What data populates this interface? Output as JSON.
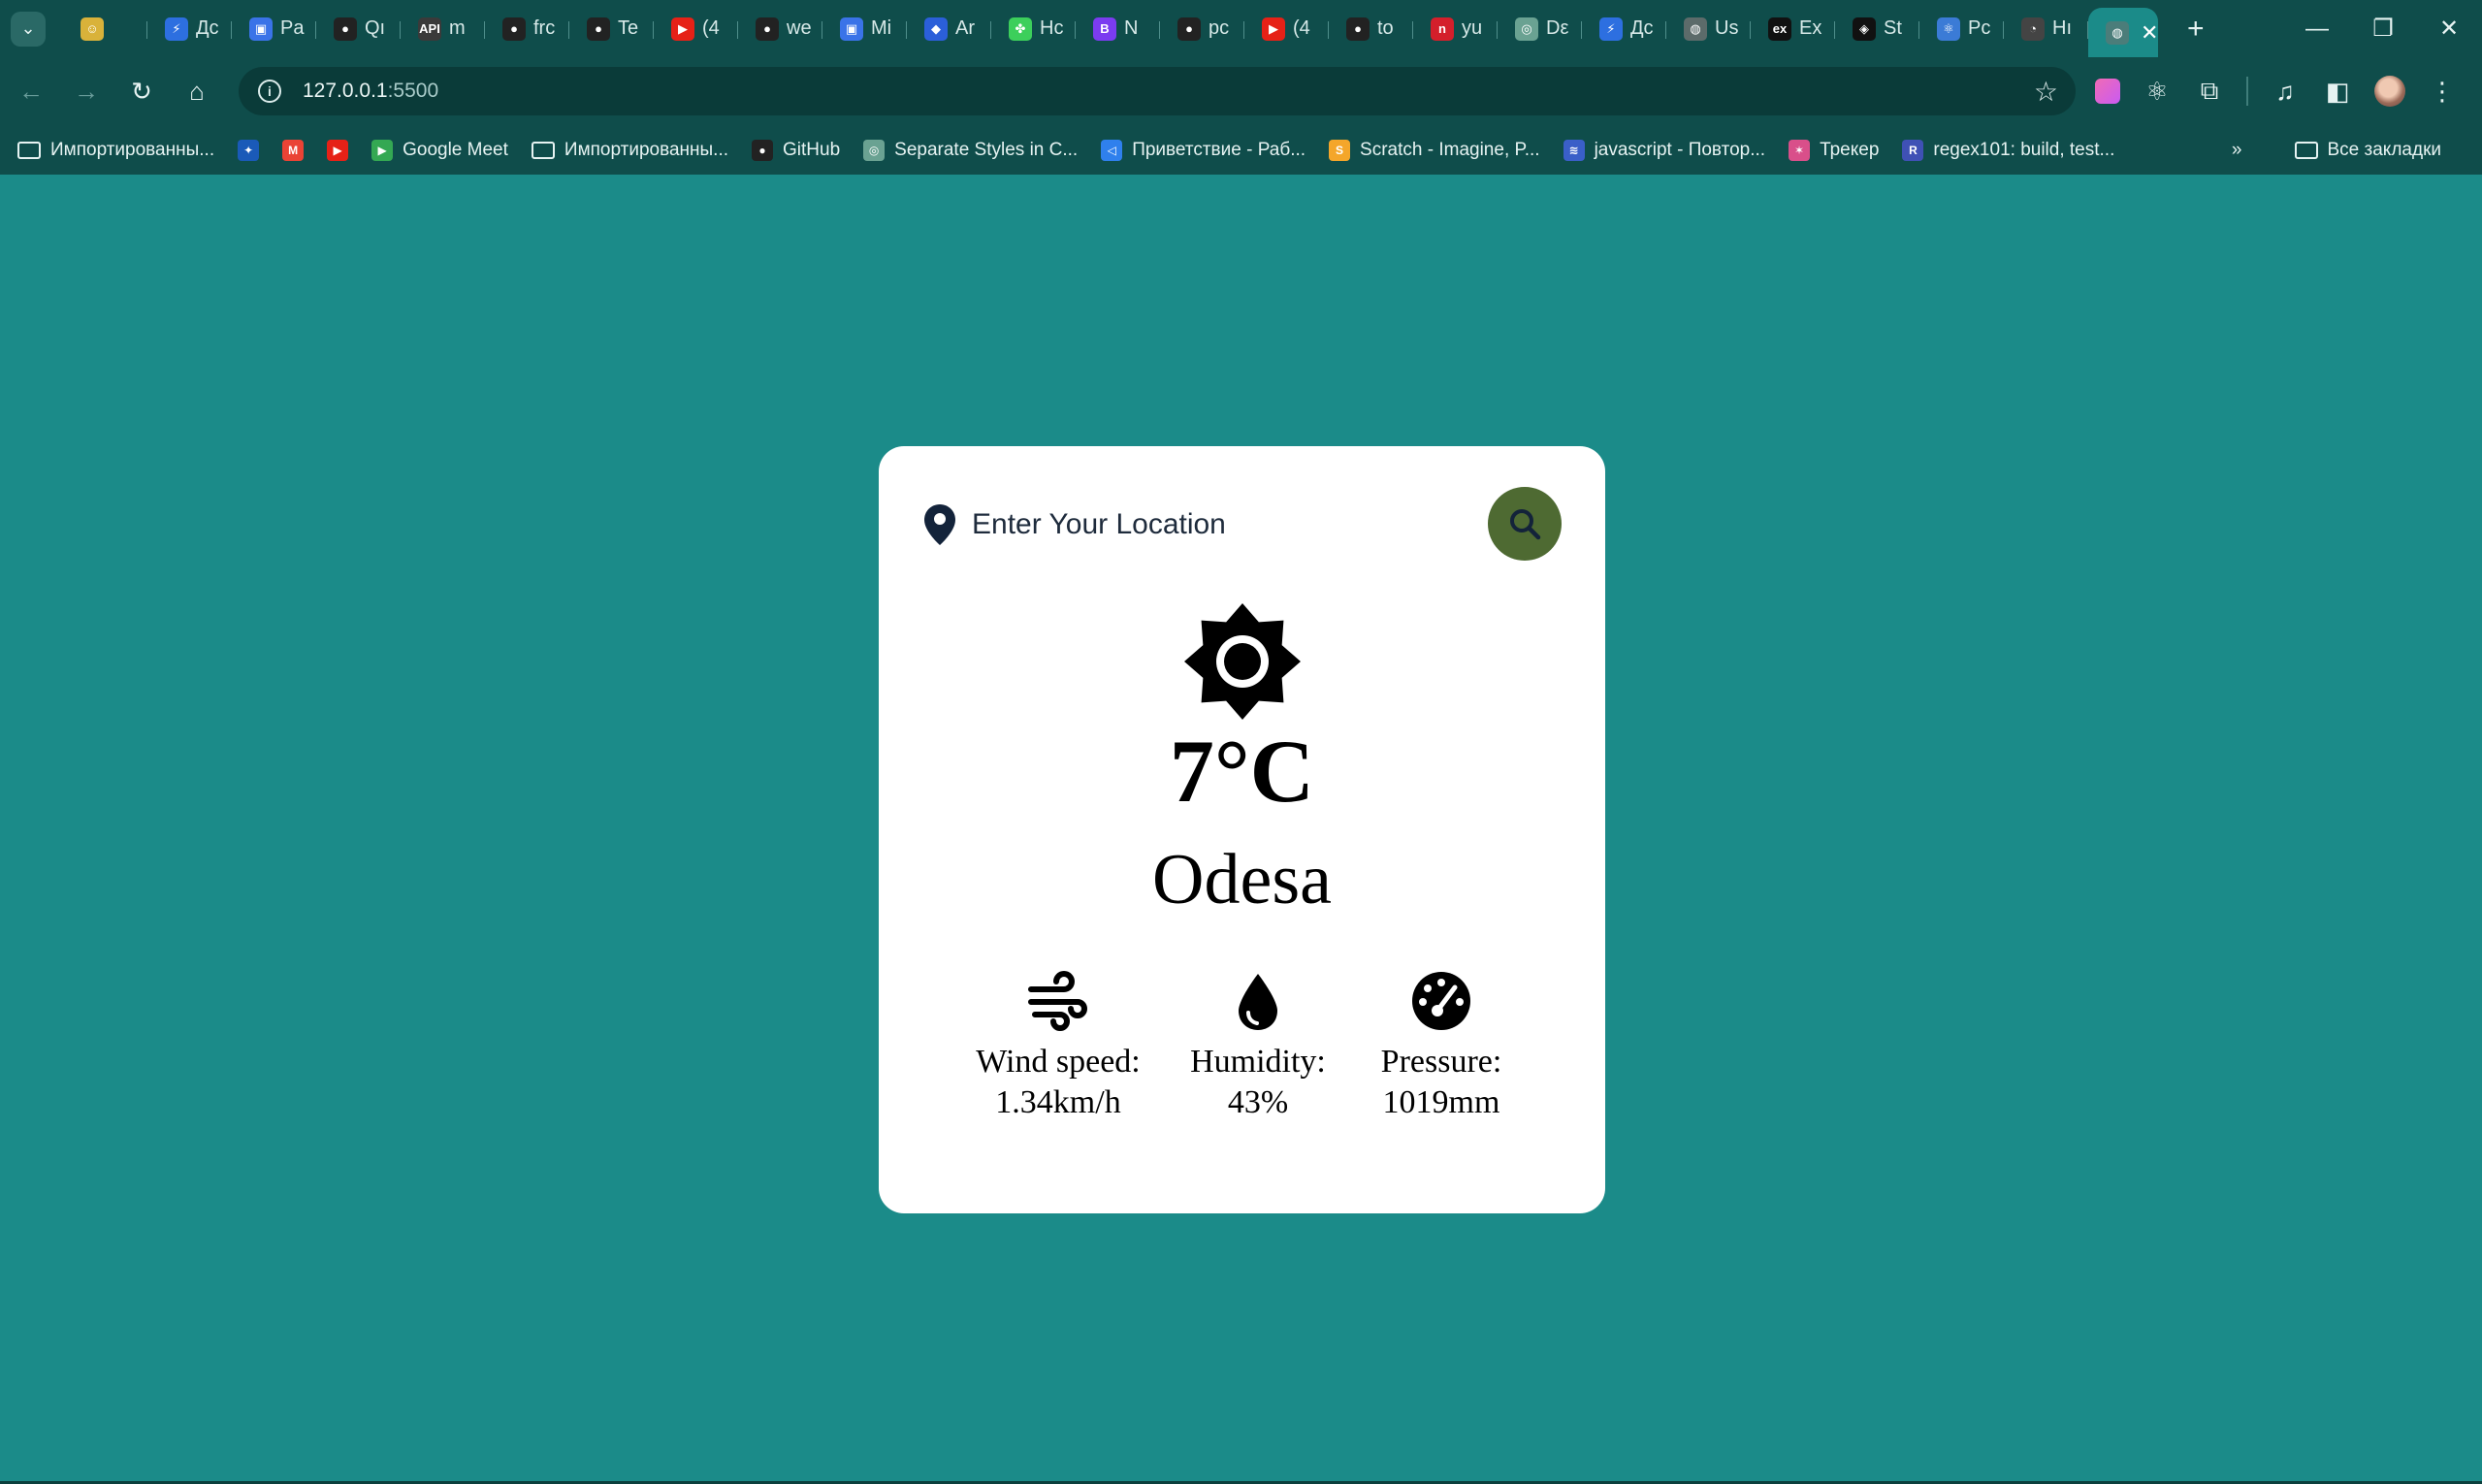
{
  "browser": {
    "tabs": [
      {
        "title": "",
        "fav": "#d9b23a",
        "glyph": "☺"
      },
      {
        "title": "Дс",
        "fav": "#2d6fe0",
        "glyph": "⚡"
      },
      {
        "title": "Pa",
        "fav": "#3a73e8",
        "glyph": "▣"
      },
      {
        "title": "Qı",
        "fav": "#222222",
        "glyph": "●"
      },
      {
        "title": "m",
        "fav": "#3a3a3a",
        "glyph": "API"
      },
      {
        "title": "frc",
        "fav": "#222222",
        "glyph": "●"
      },
      {
        "title": "Te",
        "fav": "#222222",
        "glyph": "●"
      },
      {
        "title": "(4",
        "fav": "#e62117",
        "glyph": "▶"
      },
      {
        "title": "we",
        "fav": "#222222",
        "glyph": "●"
      },
      {
        "title": "Mi",
        "fav": "#3a73e8",
        "glyph": "▣"
      },
      {
        "title": "Ar",
        "fav": "#2b5fd9",
        "glyph": "◆"
      },
      {
        "title": "Hc",
        "fav": "#3ccf5b",
        "glyph": "✤"
      },
      {
        "title": "N",
        "fav": "#7b3cf0",
        "glyph": "B"
      },
      {
        "title": "pc",
        "fav": "#222222",
        "glyph": "●"
      },
      {
        "title": "(4",
        "fav": "#e62117",
        "glyph": "▶"
      },
      {
        "title": "to",
        "fav": "#222222",
        "glyph": "●"
      },
      {
        "title": "yu",
        "fav": "#d41f2b",
        "glyph": "n"
      },
      {
        "title": "Dε",
        "fav": "#6aa292",
        "glyph": "◎"
      },
      {
        "title": "Дс",
        "fav": "#2d6fe0",
        "glyph": "⚡"
      },
      {
        "title": "Us",
        "fav": "#5c6b6a",
        "glyph": "◍"
      },
      {
        "title": "Ex",
        "fav": "#111111",
        "glyph": "ex"
      },
      {
        "title": "St",
        "fav": "#111111",
        "glyph": "◈"
      },
      {
        "title": "Pc",
        "fav": "#3b7bd6",
        "glyph": "⚛"
      },
      {
        "title": "Hı",
        "fav": "#444444",
        "glyph": "◔"
      }
    ],
    "active_tab": {
      "fav": "#4b7d7a",
      "glyph": "◍",
      "close": "✕"
    },
    "new_tab": "+",
    "url_host": "127.0.0.1",
    "url_port": ":5500",
    "bookmarks": [
      {
        "label": "Импортированны...",
        "type": "folder"
      },
      {
        "label": "",
        "type": "fav",
        "color": "#1a5ab8",
        "glyph": "✦"
      },
      {
        "label": "",
        "type": "fav",
        "color": "#ea4335",
        "glyph": "M"
      },
      {
        "label": "",
        "type": "fav",
        "color": "#e62117",
        "glyph": "▶"
      },
      {
        "label": "Google Meet",
        "type": "fav",
        "color": "#34a853",
        "glyph": "▶"
      },
      {
        "label": "Импортированны...",
        "type": "folder"
      },
      {
        "label": "GitHub",
        "type": "fav",
        "color": "#222222",
        "glyph": "●"
      },
      {
        "label": "Separate Styles in C...",
        "type": "fav",
        "color": "#6aa292",
        "glyph": "◎"
      },
      {
        "label": "Приветствие - Раб...",
        "type": "fav",
        "color": "#2f80ed",
        "glyph": "◁"
      },
      {
        "label": "Scratch - Imagine, P...",
        "type": "fav",
        "color": "#f4a62a",
        "glyph": "S"
      },
      {
        "label": "javascript - Повтор...",
        "type": "fav",
        "color": "#3a5fc8",
        "glyph": "≋"
      },
      {
        "label": "Трекер",
        "type": "fav",
        "color": "#d94f8a",
        "glyph": "✶"
      },
      {
        "label": "regex101: build, test...",
        "type": "fav",
        "color": "#3f51b5",
        "glyph": "R"
      }
    ],
    "bookmarks_more": "»",
    "all_bookmarks": "Все закладки"
  },
  "weather": {
    "search_placeholder": "Enter Your Location",
    "temperature": "7°C",
    "city": "Odesa",
    "wind_label": "Wind speed:",
    "wind_value": "1.34km/h",
    "humidity_label": "Humidity:",
    "humidity_value": "43%",
    "pressure_label": "Pressure:",
    "pressure_value": "1019mm"
  },
  "colors": {
    "page_background": "#1b8b89",
    "chrome_background": "#0f4d4b",
    "search_button": "#4e6a32",
    "card_background": "#ffffff"
  },
  "icons": [
    "location-pin-icon",
    "search-icon",
    "sun-icon",
    "wind-icon",
    "droplet-icon",
    "gauge-icon"
  ]
}
